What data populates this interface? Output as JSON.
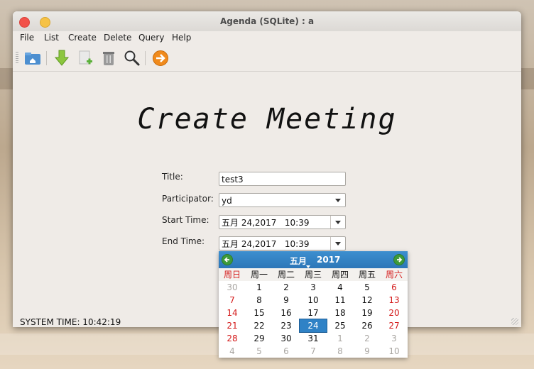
{
  "window": {
    "title": "Agenda (SQLite) : a"
  },
  "menu": [
    "File",
    "List",
    "Create",
    "Delete",
    "Query",
    "Help"
  ],
  "toolbar": {
    "icons": [
      "home-icon",
      "download-icon",
      "new-item-icon",
      "trash-icon",
      "search-icon",
      "forward-icon"
    ]
  },
  "form": {
    "heading": "Create Meeting",
    "title_label": "Title:",
    "title_value": "test3",
    "participator_label": "Participator:",
    "participator_value": "yd",
    "start_label": "Start Time:",
    "start_value": "五月 24,2017   10:39",
    "end_label": "End Time:",
    "end_value": "五月 24,2017   10:39"
  },
  "status": {
    "text": "SYSTEM TIME: 10:42:19"
  },
  "calendar": {
    "month": "五月",
    "year": "2017",
    "weekdays": [
      "周日",
      "周一",
      "周二",
      "周三",
      "周四",
      "周五",
      "周六"
    ],
    "selected_day": "24",
    "weeks": [
      [
        {
          "d": "30",
          "m": "prev"
        },
        {
          "d": "1"
        },
        {
          "d": "2"
        },
        {
          "d": "3"
        },
        {
          "d": "4"
        },
        {
          "d": "5"
        },
        {
          "d": "6"
        }
      ],
      [
        {
          "d": "7"
        },
        {
          "d": "8"
        },
        {
          "d": "9"
        },
        {
          "d": "10"
        },
        {
          "d": "11"
        },
        {
          "d": "12"
        },
        {
          "d": "13"
        }
      ],
      [
        {
          "d": "14"
        },
        {
          "d": "15"
        },
        {
          "d": "16"
        },
        {
          "d": "17"
        },
        {
          "d": "18"
        },
        {
          "d": "19"
        },
        {
          "d": "20"
        }
      ],
      [
        {
          "d": "21"
        },
        {
          "d": "22"
        },
        {
          "d": "23"
        },
        {
          "d": "24"
        },
        {
          "d": "25"
        },
        {
          "d": "26"
        },
        {
          "d": "27"
        }
      ],
      [
        {
          "d": "28"
        },
        {
          "d": "29"
        },
        {
          "d": "30"
        },
        {
          "d": "31"
        },
        {
          "d": "1",
          "m": "next"
        },
        {
          "d": "2",
          "m": "next"
        },
        {
          "d": "3",
          "m": "next"
        }
      ],
      [
        {
          "d": "4",
          "m": "next"
        },
        {
          "d": "5",
          "m": "next"
        },
        {
          "d": "6",
          "m": "next"
        },
        {
          "d": "7",
          "m": "next"
        },
        {
          "d": "8",
          "m": "next"
        },
        {
          "d": "9",
          "m": "next"
        },
        {
          "d": "10",
          "m": "next"
        }
      ]
    ]
  },
  "colors": {
    "accent": "#2f82c6",
    "weekend": "#d41919",
    "close": "#f2524a",
    "minimize": "#f6c245"
  }
}
